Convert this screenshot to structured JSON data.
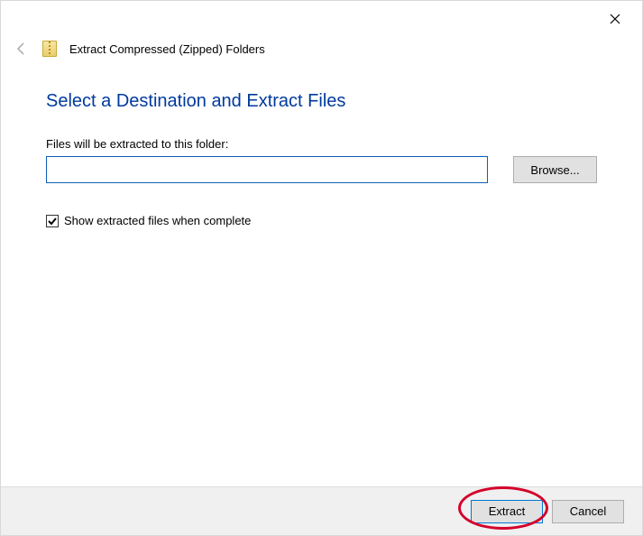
{
  "header": {
    "title": "Extract Compressed (Zipped) Folders"
  },
  "content": {
    "heading": "Select a Destination and Extract Files",
    "path_label": "Files will be extracted to this folder:",
    "path_value": "",
    "browse_label": "Browse...",
    "show_extracted_label": "Show extracted files when complete",
    "show_extracted_checked": true
  },
  "footer": {
    "extract_label": "Extract",
    "cancel_label": "Cancel"
  }
}
